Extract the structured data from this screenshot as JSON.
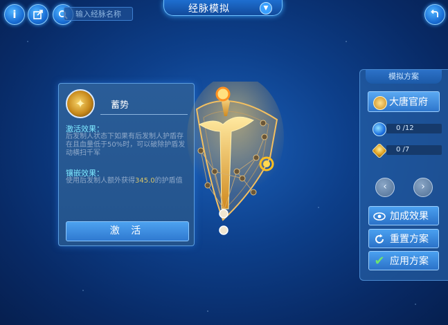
{
  "header": {
    "title": "经脉模拟",
    "search_placeholder": "输入经脉名称"
  },
  "skill": {
    "name": "蓄势",
    "activation_title": "激活效果：",
    "activation_text": "后发制人状态下如果有后发制人护盾存在且血量低于50%时，可以破除护盾发动横扫千军",
    "inlay_title": "镶嵌效果：",
    "inlay_text_before": "使用后发制人额外获得",
    "inlay_value": "345.0",
    "inlay_text_after": "的护盾值",
    "activate_label": "激 活"
  },
  "plan_panel": {
    "title": "模拟方案",
    "sect_button": "大唐官府",
    "counter_blue": "0 /12",
    "counter_gold": "0 /7",
    "bonus_button": "加成效果",
    "reset_button": "重置方案",
    "apply_button": "应用方案"
  },
  "colors": {
    "background": "#0d3f8a",
    "accent": "#3aa0ff",
    "highlight_cyan": "#7ee8ff",
    "gold": "#f0b030"
  },
  "icons": [
    "info-icon",
    "share-icon",
    "search-icon",
    "chevron-down-icon",
    "back-icon",
    "skill-emblem-icon",
    "sect-icon",
    "blue-orb-icon",
    "gold-gem-icon",
    "prev-arrow-icon",
    "next-arrow-icon",
    "eye-icon",
    "refresh-icon",
    "check-icon"
  ]
}
